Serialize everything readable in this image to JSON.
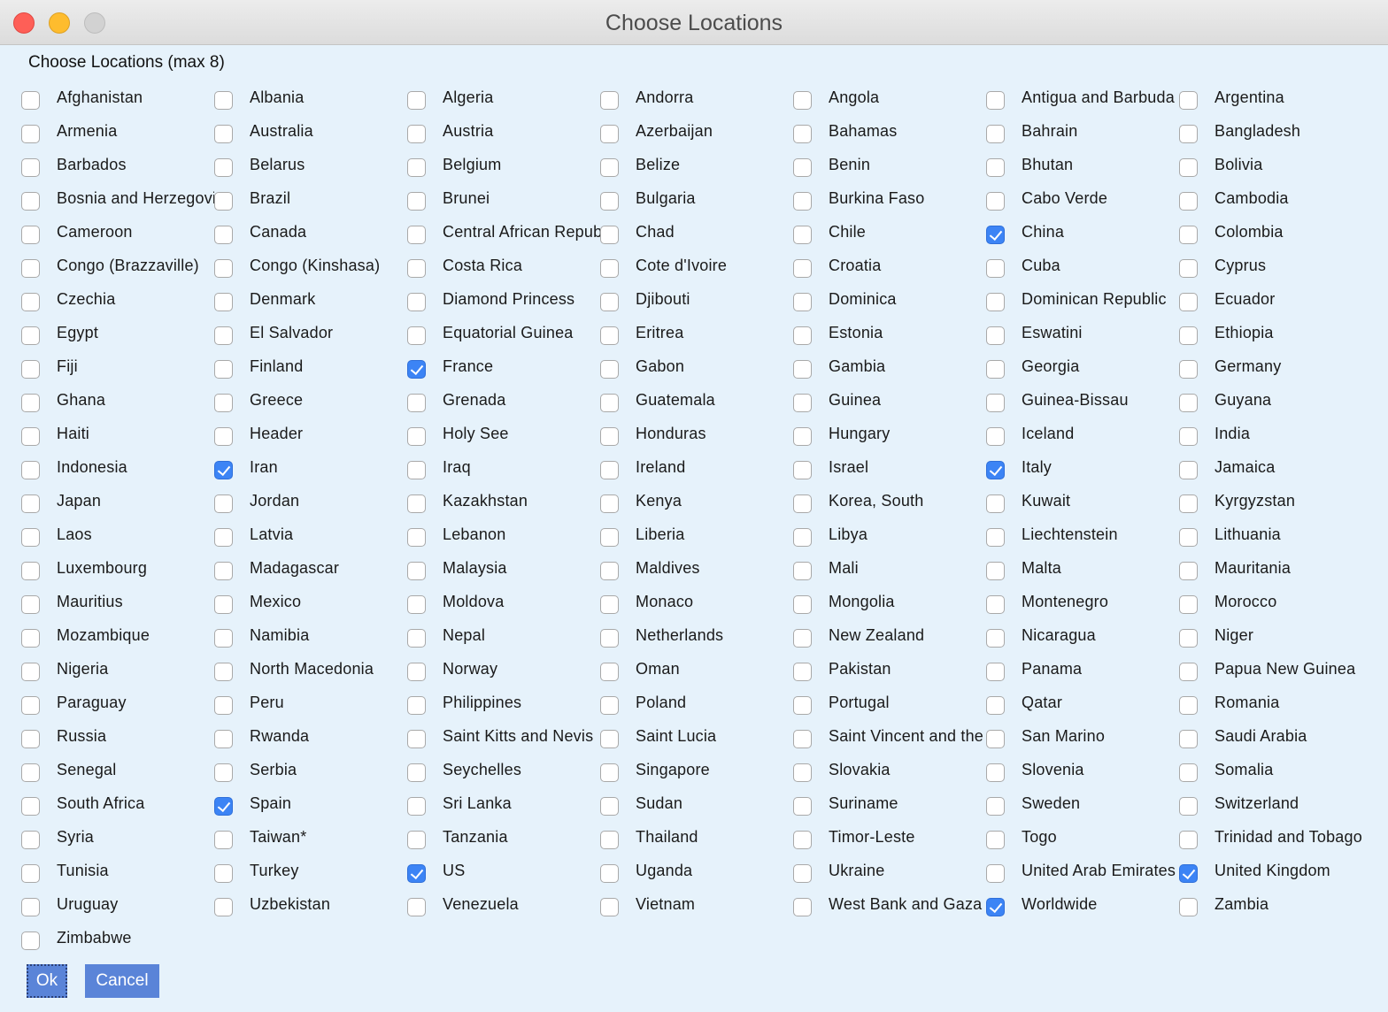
{
  "window": {
    "title": "Choose Locations"
  },
  "dialog": {
    "heading": "Choose Locations (max 8)",
    "ok_label": "Ok",
    "cancel_label": "Cancel"
  },
  "colors": {
    "accent": "#3c84f5",
    "button": "#5a84d8",
    "background": "#e6f2fb"
  },
  "locations": [
    {
      "label": "Afghanistan",
      "checked": false
    },
    {
      "label": "Albania",
      "checked": false
    },
    {
      "label": "Algeria",
      "checked": false
    },
    {
      "label": "Andorra",
      "checked": false
    },
    {
      "label": "Angola",
      "checked": false
    },
    {
      "label": "Antigua and Barbuda",
      "checked": false
    },
    {
      "label": "Argentina",
      "checked": false
    },
    {
      "label": "Armenia",
      "checked": false
    },
    {
      "label": "Australia",
      "checked": false
    },
    {
      "label": "Austria",
      "checked": false
    },
    {
      "label": "Azerbaijan",
      "checked": false
    },
    {
      "label": "Bahamas",
      "checked": false
    },
    {
      "label": "Bahrain",
      "checked": false
    },
    {
      "label": "Bangladesh",
      "checked": false
    },
    {
      "label": "Barbados",
      "checked": false
    },
    {
      "label": "Belarus",
      "checked": false
    },
    {
      "label": "Belgium",
      "checked": false
    },
    {
      "label": "Belize",
      "checked": false
    },
    {
      "label": "Benin",
      "checked": false
    },
    {
      "label": "Bhutan",
      "checked": false
    },
    {
      "label": "Bolivia",
      "checked": false
    },
    {
      "label": "Bosnia and Herzegovina",
      "checked": false
    },
    {
      "label": "Brazil",
      "checked": false
    },
    {
      "label": "Brunei",
      "checked": false
    },
    {
      "label": "Bulgaria",
      "checked": false
    },
    {
      "label": "Burkina Faso",
      "checked": false
    },
    {
      "label": "Cabo Verde",
      "checked": false
    },
    {
      "label": "Cambodia",
      "checked": false
    },
    {
      "label": "Cameroon",
      "checked": false
    },
    {
      "label": "Canada",
      "checked": false
    },
    {
      "label": "Central African Republic",
      "checked": false
    },
    {
      "label": "Chad",
      "checked": false
    },
    {
      "label": "Chile",
      "checked": false
    },
    {
      "label": "China",
      "checked": true
    },
    {
      "label": "Colombia",
      "checked": false
    },
    {
      "label": "Congo (Brazzaville)",
      "checked": false
    },
    {
      "label": "Congo (Kinshasa)",
      "checked": false
    },
    {
      "label": "Costa Rica",
      "checked": false
    },
    {
      "label": "Cote d'Ivoire",
      "checked": false
    },
    {
      "label": "Croatia",
      "checked": false
    },
    {
      "label": "Cuba",
      "checked": false
    },
    {
      "label": "Cyprus",
      "checked": false
    },
    {
      "label": "Czechia",
      "checked": false
    },
    {
      "label": "Denmark",
      "checked": false
    },
    {
      "label": "Diamond Princess",
      "checked": false
    },
    {
      "label": "Djibouti",
      "checked": false
    },
    {
      "label": "Dominica",
      "checked": false
    },
    {
      "label": "Dominican Republic",
      "checked": false
    },
    {
      "label": "Ecuador",
      "checked": false
    },
    {
      "label": "Egypt",
      "checked": false
    },
    {
      "label": "El Salvador",
      "checked": false
    },
    {
      "label": "Equatorial Guinea",
      "checked": false
    },
    {
      "label": "Eritrea",
      "checked": false
    },
    {
      "label": "Estonia",
      "checked": false
    },
    {
      "label": "Eswatini",
      "checked": false
    },
    {
      "label": "Ethiopia",
      "checked": false
    },
    {
      "label": "Fiji",
      "checked": false
    },
    {
      "label": "Finland",
      "checked": false
    },
    {
      "label": "France",
      "checked": true
    },
    {
      "label": "Gabon",
      "checked": false
    },
    {
      "label": "Gambia",
      "checked": false
    },
    {
      "label": "Georgia",
      "checked": false
    },
    {
      "label": "Germany",
      "checked": false
    },
    {
      "label": "Ghana",
      "checked": false
    },
    {
      "label": "Greece",
      "checked": false
    },
    {
      "label": "Grenada",
      "checked": false
    },
    {
      "label": "Guatemala",
      "checked": false
    },
    {
      "label": "Guinea",
      "checked": false
    },
    {
      "label": "Guinea-Bissau",
      "checked": false
    },
    {
      "label": "Guyana",
      "checked": false
    },
    {
      "label": "Haiti",
      "checked": false
    },
    {
      "label": "Header",
      "checked": false
    },
    {
      "label": "Holy See",
      "checked": false
    },
    {
      "label": "Honduras",
      "checked": false
    },
    {
      "label": "Hungary",
      "checked": false
    },
    {
      "label": "Iceland",
      "checked": false
    },
    {
      "label": "India",
      "checked": false
    },
    {
      "label": "Indonesia",
      "checked": false
    },
    {
      "label": "Iran",
      "checked": true
    },
    {
      "label": "Iraq",
      "checked": false
    },
    {
      "label": "Ireland",
      "checked": false
    },
    {
      "label": "Israel",
      "checked": false
    },
    {
      "label": "Italy",
      "checked": true
    },
    {
      "label": "Jamaica",
      "checked": false
    },
    {
      "label": "Japan",
      "checked": false
    },
    {
      "label": "Jordan",
      "checked": false
    },
    {
      "label": "Kazakhstan",
      "checked": false
    },
    {
      "label": "Kenya",
      "checked": false
    },
    {
      "label": "Korea, South",
      "checked": false
    },
    {
      "label": "Kuwait",
      "checked": false
    },
    {
      "label": "Kyrgyzstan",
      "checked": false
    },
    {
      "label": "Laos",
      "checked": false
    },
    {
      "label": "Latvia",
      "checked": false
    },
    {
      "label": "Lebanon",
      "checked": false
    },
    {
      "label": "Liberia",
      "checked": false
    },
    {
      "label": "Libya",
      "checked": false
    },
    {
      "label": "Liechtenstein",
      "checked": false
    },
    {
      "label": "Lithuania",
      "checked": false
    },
    {
      "label": "Luxembourg",
      "checked": false
    },
    {
      "label": "Madagascar",
      "checked": false
    },
    {
      "label": "Malaysia",
      "checked": false
    },
    {
      "label": "Maldives",
      "checked": false
    },
    {
      "label": "Mali",
      "checked": false
    },
    {
      "label": "Malta",
      "checked": false
    },
    {
      "label": "Mauritania",
      "checked": false
    },
    {
      "label": "Mauritius",
      "checked": false
    },
    {
      "label": "Mexico",
      "checked": false
    },
    {
      "label": "Moldova",
      "checked": false
    },
    {
      "label": "Monaco",
      "checked": false
    },
    {
      "label": "Mongolia",
      "checked": false
    },
    {
      "label": "Montenegro",
      "checked": false
    },
    {
      "label": "Morocco",
      "checked": false
    },
    {
      "label": "Mozambique",
      "checked": false
    },
    {
      "label": "Namibia",
      "checked": false
    },
    {
      "label": "Nepal",
      "checked": false
    },
    {
      "label": "Netherlands",
      "checked": false
    },
    {
      "label": "New Zealand",
      "checked": false
    },
    {
      "label": "Nicaragua",
      "checked": false
    },
    {
      "label": "Niger",
      "checked": false
    },
    {
      "label": "Nigeria",
      "checked": false
    },
    {
      "label": "North Macedonia",
      "checked": false
    },
    {
      "label": "Norway",
      "checked": false
    },
    {
      "label": "Oman",
      "checked": false
    },
    {
      "label": "Pakistan",
      "checked": false
    },
    {
      "label": "Panama",
      "checked": false
    },
    {
      "label": "Papua New Guinea",
      "checked": false
    },
    {
      "label": "Paraguay",
      "checked": false
    },
    {
      "label": "Peru",
      "checked": false
    },
    {
      "label": "Philippines",
      "checked": false
    },
    {
      "label": "Poland",
      "checked": false
    },
    {
      "label": "Portugal",
      "checked": false
    },
    {
      "label": "Qatar",
      "checked": false
    },
    {
      "label": "Romania",
      "checked": false
    },
    {
      "label": "Russia",
      "checked": false
    },
    {
      "label": "Rwanda",
      "checked": false
    },
    {
      "label": "Saint Kitts and Nevis",
      "checked": false
    },
    {
      "label": "Saint Lucia",
      "checked": false
    },
    {
      "label": "Saint Vincent and the Grenadines",
      "checked": false
    },
    {
      "label": "San Marino",
      "checked": false
    },
    {
      "label": "Saudi Arabia",
      "checked": false
    },
    {
      "label": "Senegal",
      "checked": false
    },
    {
      "label": "Serbia",
      "checked": false
    },
    {
      "label": "Seychelles",
      "checked": false
    },
    {
      "label": "Singapore",
      "checked": false
    },
    {
      "label": "Slovakia",
      "checked": false
    },
    {
      "label": "Slovenia",
      "checked": false
    },
    {
      "label": "Somalia",
      "checked": false
    },
    {
      "label": "South Africa",
      "checked": false
    },
    {
      "label": "Spain",
      "checked": true
    },
    {
      "label": "Sri Lanka",
      "checked": false
    },
    {
      "label": "Sudan",
      "checked": false
    },
    {
      "label": "Suriname",
      "checked": false
    },
    {
      "label": "Sweden",
      "checked": false
    },
    {
      "label": "Switzerland",
      "checked": false
    },
    {
      "label": "Syria",
      "checked": false
    },
    {
      "label": "Taiwan*",
      "checked": false
    },
    {
      "label": "Tanzania",
      "checked": false
    },
    {
      "label": "Thailand",
      "checked": false
    },
    {
      "label": "Timor-Leste",
      "checked": false
    },
    {
      "label": "Togo",
      "checked": false
    },
    {
      "label": "Trinidad and Tobago",
      "checked": false
    },
    {
      "label": "Tunisia",
      "checked": false
    },
    {
      "label": "Turkey",
      "checked": false
    },
    {
      "label": "US",
      "checked": true
    },
    {
      "label": "Uganda",
      "checked": false
    },
    {
      "label": "Ukraine",
      "checked": false
    },
    {
      "label": "United Arab Emirates",
      "checked": false
    },
    {
      "label": "United Kingdom",
      "checked": true
    },
    {
      "label": "Uruguay",
      "checked": false
    },
    {
      "label": "Uzbekistan",
      "checked": false
    },
    {
      "label": "Venezuela",
      "checked": false
    },
    {
      "label": "Vietnam",
      "checked": false
    },
    {
      "label": "West Bank and Gaza",
      "checked": false
    },
    {
      "label": "Worldwide",
      "checked": true
    },
    {
      "label": "Zambia",
      "checked": false
    },
    {
      "label": "Zimbabwe",
      "checked": false
    }
  ]
}
